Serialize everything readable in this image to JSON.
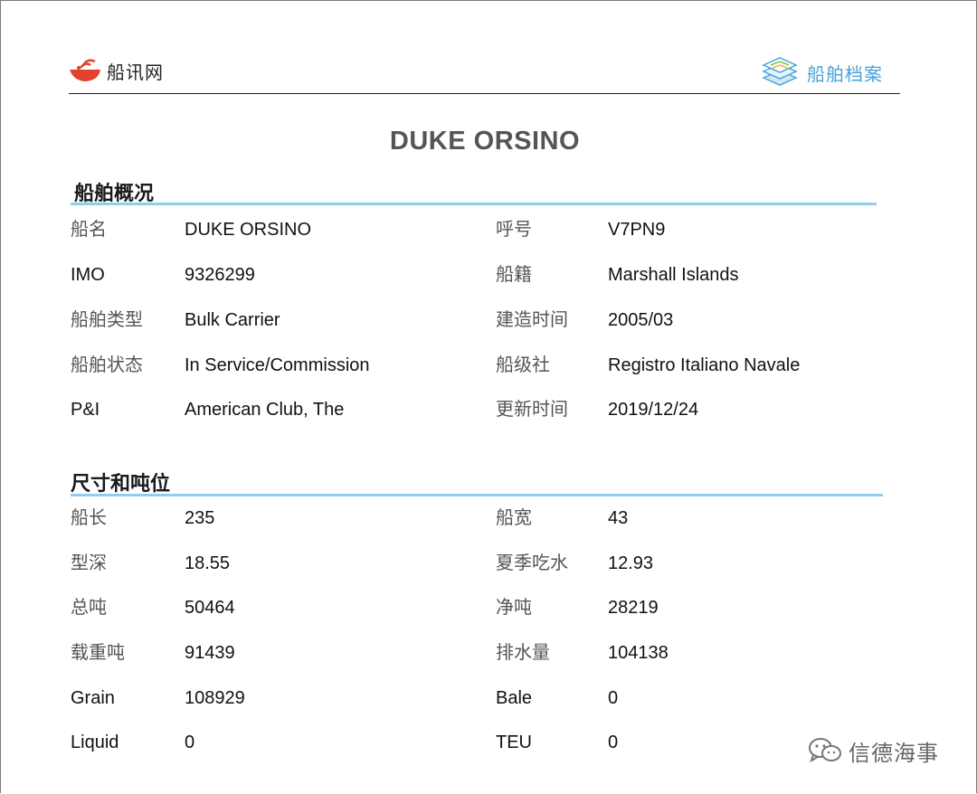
{
  "header": {
    "brand": "船讯网",
    "archive_label": "船舶档案"
  },
  "ship_name_title": "DUKE ORSINO",
  "overview": {
    "title": "船舶概况",
    "rows": [
      {
        "l1": "船名",
        "v1": "DUKE ORSINO",
        "l2": "呼号",
        "v2": "V7PN9"
      },
      {
        "l1": "IMO",
        "v1": "9326299",
        "l2": "船籍",
        "v2": "Marshall Islands"
      },
      {
        "l1": "船舶类型",
        "v1": "Bulk Carrier",
        "l2": "建造时间",
        "v2": "2005/03"
      },
      {
        "l1": "船舶状态",
        "v1": "In Service/Commission",
        "l2": "船级社",
        "v2": "Registro Italiano Navale"
      },
      {
        "l1": "P&I",
        "v1": "American Club, The",
        "l2": "更新时间",
        "v2": "2019/12/24"
      }
    ]
  },
  "dimensions": {
    "title": "尺寸和吨位",
    "rows": [
      {
        "l1": "船长",
        "v1": "235",
        "l2": "船宽",
        "v2": "43"
      },
      {
        "l1": "型深",
        "v1": "18.55",
        "l2": "夏季吃水",
        "v2": "12.93"
      },
      {
        "l1": "总吨",
        "v1": "50464",
        "l2": "净吨",
        "v2": "28219"
      },
      {
        "l1": "载重吨",
        "v1": "91439",
        "l2": "排水量",
        "v2": "104138"
      },
      {
        "l1": "Grain",
        "v1": "108929",
        "l2": "Bale",
        "v2": "0"
      },
      {
        "l1": "Liquid",
        "v1": "0",
        "l2": "TEU",
        "v2": "0"
      }
    ]
  },
  "watermark": "信德海事",
  "icons": {
    "brand_logo": "red-boat-signal-icon",
    "archive_logo": "stacked-layers-icon",
    "watermark_logo": "wechat-icon"
  },
  "colors": {
    "section_rule": "#8fcdf0",
    "brand_red": "#e2422b",
    "archive_blue": "#4aa3d8"
  }
}
